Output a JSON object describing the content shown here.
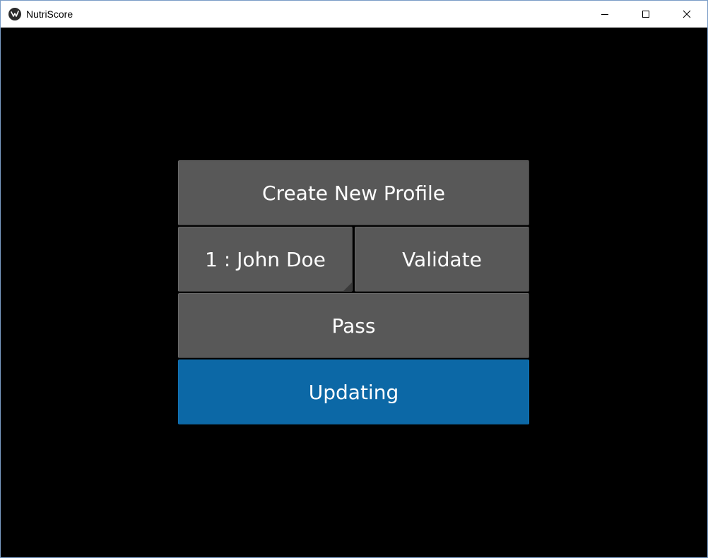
{
  "window": {
    "title": "NutriScore",
    "icon": "kivy-logo-icon",
    "controls": {
      "minimize": "minimize-icon",
      "maximize": "maximize-icon",
      "close": "close-icon"
    }
  },
  "main": {
    "create_profile_label": "Create New Profile",
    "profile_spinner_value": "1 : John Doe",
    "validate_label": "Validate",
    "pass_label": "Pass",
    "updating_label": "Updating"
  },
  "colors": {
    "button_gray": "#585858",
    "button_blue": "#0c68a6",
    "background": "#000000"
  }
}
